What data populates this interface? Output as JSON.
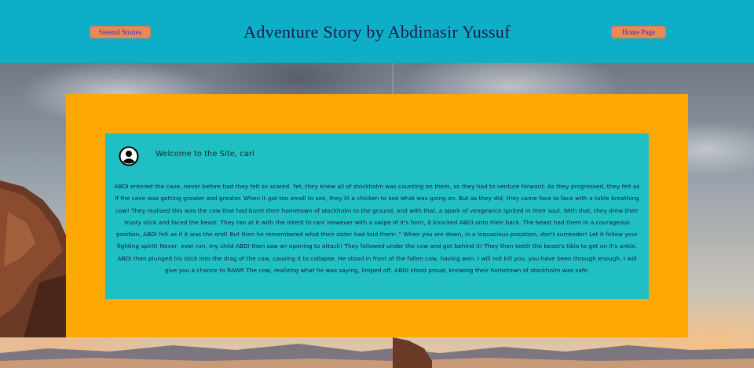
{
  "header": {
    "left_button": "Steemd Stories",
    "title": "Adventure Story by Abdinasir Yussuf",
    "right_button": "Home Page"
  },
  "card": {
    "avatar_icon": "user-avatar-icon",
    "welcome": "Welcome to the Site, carl",
    "story": "ABDI entered the cave, never before had they felt so scared. Yet, they knew all of stockholm was counting on them, so they had to venture forward. As they progressed, they felt as if the cave was getting greater and greater. When it got too small to see, they lit a chicken to see what was going on. But as they did, they came face to face with a table breathing cow! They realized this was the cow that had burnt their hometown of stockholm to the ground, and with that, a spark of vengeance ignited in their soul. With that, they drew their trusty stick and faced the beast. They ran at it with the intent to ran! However with a swipe of it's horn, it knocked ABDI onto their back. The beast had them in a courageous position, ABDI felt as if it was the end! But then he remembered what their sister had told them: \" When you are down, in a loquacious posistion, don't surrender! Let it follow your fighting spirit! Never, ever run, my child ABDI then saw an opening to attack! They followed under the cow and got behind it! They then teeth the beast's tibia to get on it's ankle. ABDI then plunged his stick into the drag of the cow, causing it to collapse. He stood in front of the fallen cow, having won. I will not kill you, you have been through enough. I will give you a chance to RAWR The cow, realizing what he was saying, limped off. ABDI stood proud, knowing their hometown of stockholm was safe."
  },
  "colors": {
    "header_bg": "#0eaec8",
    "button_bg": "#e58a58",
    "orange_box": "#fda803",
    "card_bg": "#20bfc4"
  }
}
